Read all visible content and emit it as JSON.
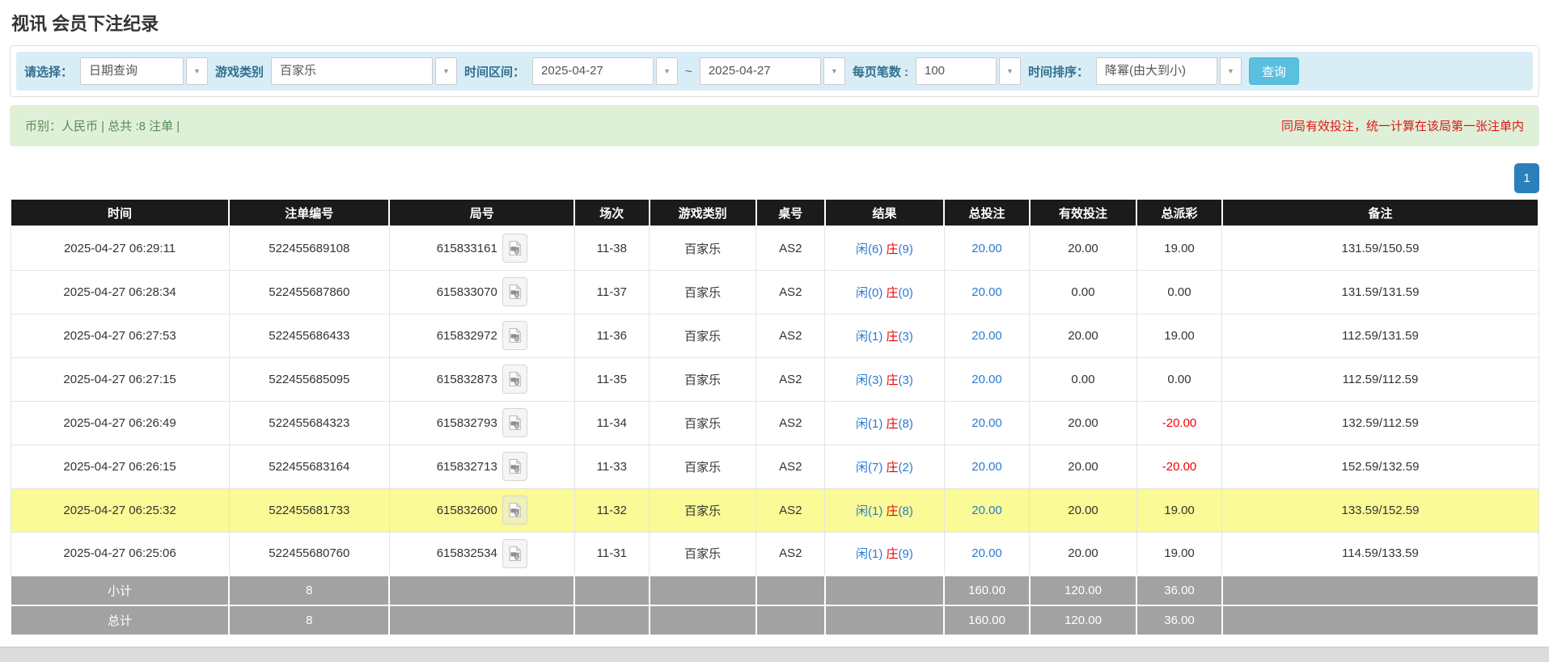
{
  "page": {
    "title": "视讯 会员下注纪录"
  },
  "filters": {
    "select_label": "请选择：",
    "select_value": "日期查询",
    "game_type_label": "游戏类别",
    "game_type_value": "百家乐",
    "time_range_label": "时间区间：",
    "date_from": "2025-04-27",
    "tilde": "~",
    "date_to": "2025-04-27",
    "page_size_label": "每页笔数 :",
    "page_size_value": "100",
    "sort_label": "时间排序：",
    "sort_value": "降幂(由大到小)",
    "search_button": "查询",
    "dropdown_arrow": "▼"
  },
  "summary": {
    "left": "币别：人民币 | 总共 :8 注单 |",
    "right": "同局有效投注，统一计算在该局第一张注单内"
  },
  "pagination": {
    "current_page": "1"
  },
  "colors": {
    "accent_blue": "#2a7ad2",
    "banker_red": "#e60000",
    "negative_red": "#f00000",
    "highlight_yellow": "#fafa96",
    "header_black": "#1b1b1b",
    "sum_gray": "#a2a2a2",
    "filter_bar_blue": "#d9edf7",
    "summary_green": "#dff0d8"
  },
  "table": {
    "columns": [
      "时间",
      "注单编号",
      "局号",
      "场次",
      "游戏类别",
      "桌号",
      "结果",
      "总投注",
      "有效投注",
      "总派彩",
      "备注"
    ],
    "rows": [
      {
        "time": "2025-04-27 06:29:11",
        "bet_id": "522455689108",
        "round": "615833161",
        "session": "11-38",
        "game": "百家乐",
        "table": "AS2",
        "result_player": "闲(6)",
        "result_banker": "庄",
        "result_banker_n": "(9)",
        "total_bet": "20.00",
        "valid_bet": "20.00",
        "payout": "19.00",
        "note": "131.59/150.59",
        "highlight": false
      },
      {
        "time": "2025-04-27 06:28:34",
        "bet_id": "522455687860",
        "round": "615833070",
        "session": "11-37",
        "game": "百家乐",
        "table": "AS2",
        "result_player": "闲(0)",
        "result_banker": "庄",
        "result_banker_n": "(0)",
        "total_bet": "20.00",
        "valid_bet": "0.00",
        "payout": "0.00",
        "note": "131.59/131.59",
        "highlight": false
      },
      {
        "time": "2025-04-27 06:27:53",
        "bet_id": "522455686433",
        "round": "615832972",
        "session": "11-36",
        "game": "百家乐",
        "table": "AS2",
        "result_player": "闲(1)",
        "result_banker": "庄",
        "result_banker_n": "(3)",
        "total_bet": "20.00",
        "valid_bet": "20.00",
        "payout": "19.00",
        "note": "112.59/131.59",
        "highlight": false
      },
      {
        "time": "2025-04-27 06:27:15",
        "bet_id": "522455685095",
        "round": "615832873",
        "session": "11-35",
        "game": "百家乐",
        "table": "AS2",
        "result_player": "闲(3)",
        "result_banker": "庄",
        "result_banker_n": "(3)",
        "total_bet": "20.00",
        "valid_bet": "0.00",
        "payout": "0.00",
        "note": "112.59/112.59",
        "highlight": false
      },
      {
        "time": "2025-04-27 06:26:49",
        "bet_id": "522455684323",
        "round": "615832793",
        "session": "11-34",
        "game": "百家乐",
        "table": "AS2",
        "result_player": "闲(1)",
        "result_banker": "庄",
        "result_banker_n": "(8)",
        "total_bet": "20.00",
        "valid_bet": "20.00",
        "payout": "-20.00",
        "note": "132.59/112.59",
        "highlight": false
      },
      {
        "time": "2025-04-27 06:26:15",
        "bet_id": "522455683164",
        "round": "615832713",
        "session": "11-33",
        "game": "百家乐",
        "table": "AS2",
        "result_player": "闲(7)",
        "result_banker": "庄",
        "result_banker_n": "(2)",
        "total_bet": "20.00",
        "valid_bet": "20.00",
        "payout": "-20.00",
        "note": "152.59/132.59",
        "highlight": false
      },
      {
        "time": "2025-04-27 06:25:32",
        "bet_id": "522455681733",
        "round": "615832600",
        "session": "11-32",
        "game": "百家乐",
        "table": "AS2",
        "result_player": "闲(1)",
        "result_banker": "庄",
        "result_banker_n": "(8)",
        "total_bet": "20.00",
        "valid_bet": "20.00",
        "payout": "19.00",
        "note": "133.59/152.59",
        "highlight": true
      },
      {
        "time": "2025-04-27 06:25:06",
        "bet_id": "522455680760",
        "round": "615832534",
        "session": "11-31",
        "game": "百家乐",
        "table": "AS2",
        "result_player": "闲(1)",
        "result_banker": "庄",
        "result_banker_n": "(9)",
        "total_bet": "20.00",
        "valid_bet": "20.00",
        "payout": "19.00",
        "note": "114.59/133.59",
        "highlight": false
      }
    ],
    "subtotal": {
      "label": "小计",
      "count": "8",
      "total_bet": "160.00",
      "valid_bet": "120.00",
      "payout": "36.00"
    },
    "total": {
      "label": "总计",
      "count": "8",
      "total_bet": "160.00",
      "valid_bet": "120.00",
      "payout": "36.00"
    }
  }
}
